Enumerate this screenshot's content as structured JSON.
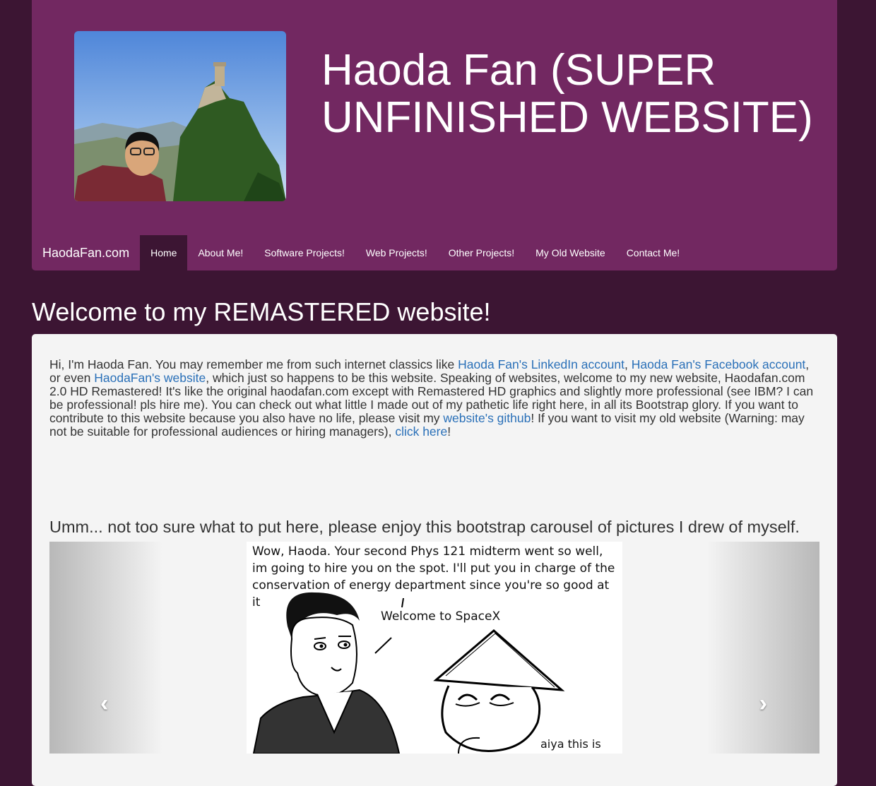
{
  "header": {
    "title": "Haoda Fan (SUPER UNFINISHED WEBSITE)",
    "photo_icon": "profile-photo"
  },
  "nav": {
    "brand": "HaodaFan.com",
    "items": [
      {
        "label": "Home",
        "active": true
      },
      {
        "label": "About Me!"
      },
      {
        "label": "Software Projects!"
      },
      {
        "label": "Web Projects!"
      },
      {
        "label": "Other Projects!"
      },
      {
        "label": "My Old Website"
      },
      {
        "label": "Contact Me!"
      }
    ]
  },
  "main": {
    "heading": "Welcome to my REMASTERED website!",
    "intro": {
      "t1": "Hi, I'm Haoda Fan. You may remember me from such internet classics like ",
      "link1": "Haoda Fan's LinkedIn account",
      "t2": ", ",
      "link2": "Haoda Fan's Facebook account",
      "t3": ", or even ",
      "link3": "HaodaFan's website",
      "t4": ", which just so happens to be this website. Speaking of websites, welcome to my new website, Haodafan.com 2.0 HD Remastered! It's like the original haodafan.com except with Remastered HD graphics and slightly more professional (see IBM? I can be professional! pls hire me). You can check out what little I made out of my pathetic life right here, in all its Bootstrap glory. If you want to contribute to this website because you also have no life, please visit my ",
      "link4": "website's github",
      "t5": "! If you want to visit my old website (Warning: may not be suitable for professional audiences or hiring managers), ",
      "link5": "click here",
      "t6": "!"
    },
    "carousel_heading": "Umm... not too sure what to put here, please enjoy this bootstrap carousel of pictures I drew of myself.",
    "carousel": {
      "slide_text": "Wow, Haoda. Your second Phys 121 midterm went so well, im going to hire you on the spot. I'll put you in charge of the conservation of energy department since you're so good at it",
      "speech_1": "Welcome to SpaceX",
      "speech_2": "aiya this is",
      "prev_icon": "chevron-left-icon",
      "next_icon": "chevron-right-icon"
    }
  },
  "colors": {
    "page_bg": "#3c1533",
    "header_bg": "#722861",
    "panel_bg": "#f4f4f4",
    "link": "#2a70b8"
  }
}
